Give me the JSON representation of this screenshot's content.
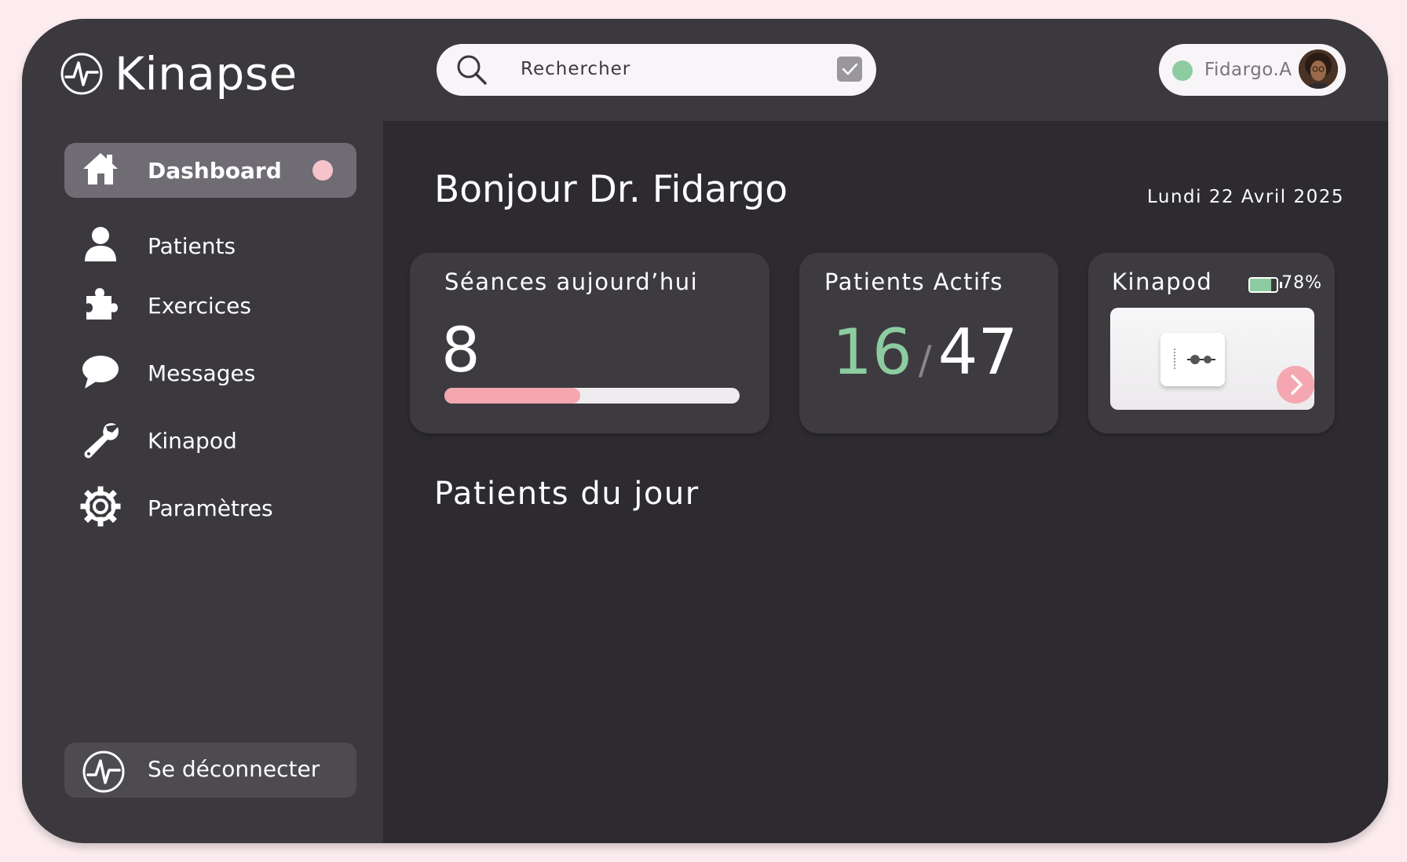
{
  "app": {
    "name": "Kinapse"
  },
  "sidebar": {
    "items": [
      {
        "label": "Dashboard",
        "icon": "home-icon",
        "active": true
      },
      {
        "label": "Patients",
        "icon": "person-icon"
      },
      {
        "label": "Exercices",
        "icon": "puzzle-icon"
      },
      {
        "label": "Messages",
        "icon": "chat-bubble-icon"
      },
      {
        "label": "Kinapod",
        "icon": "wrench-icon"
      },
      {
        "label": "Paramètres",
        "icon": "gear-icon"
      }
    ],
    "logout_label": "Se déconnecter"
  },
  "search": {
    "placeholder": "Rechercher"
  },
  "user": {
    "name": "Fidargo.A",
    "status_color": "#8ccca0"
  },
  "main": {
    "greeting": "Bonjour Dr. Fidargo",
    "date": "Lundi 22 Avril 2025",
    "section_title": "Patients du jour"
  },
  "cards": {
    "sessions": {
      "title": "Séances aujourd’hui",
      "value": "8",
      "progress_percent": 46
    },
    "patients": {
      "title": "Patients Actifs",
      "active": "16",
      "separator": "/",
      "total": "47"
    },
    "kinapod": {
      "title": "Kinapod",
      "battery_label": "78%",
      "battery_percent": 78
    }
  },
  "colors": {
    "accent_pink": "#f4a7b1",
    "accent_green": "#8ccca0",
    "background": "#2d2b30",
    "sidebar": "#3b393e"
  }
}
